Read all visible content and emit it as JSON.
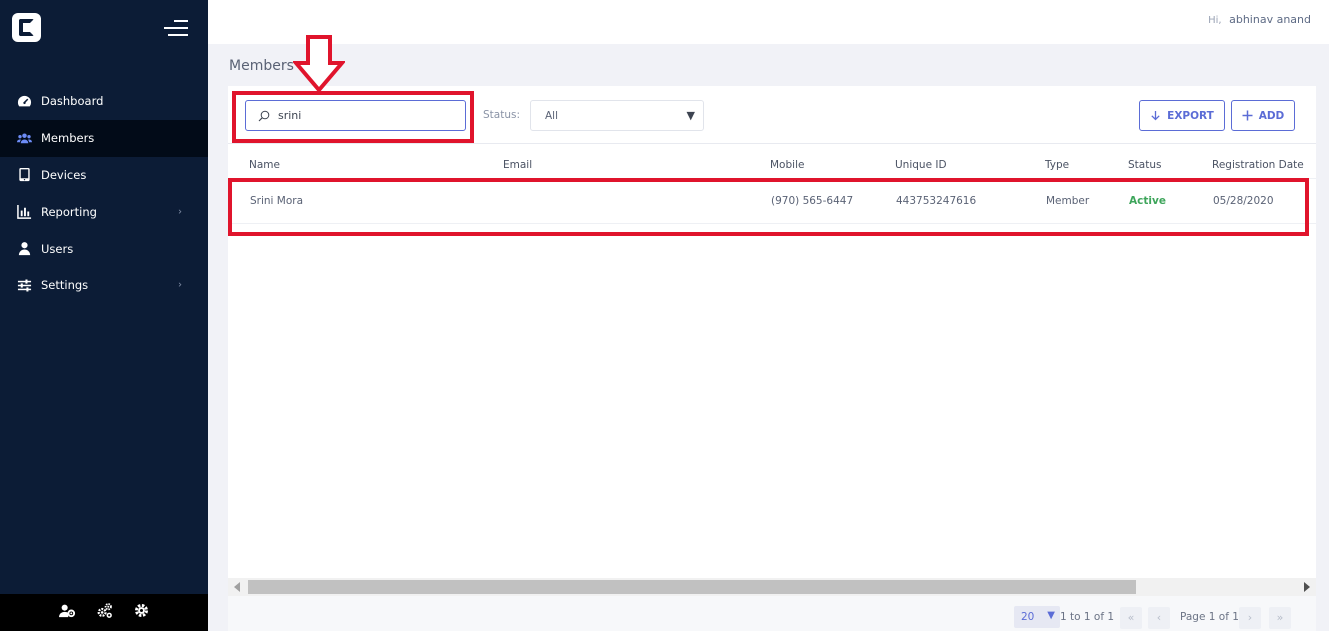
{
  "app": {
    "logo_letter": "C"
  },
  "sidebar": {
    "items": [
      {
        "label": "Dashboard",
        "icon": "dashboard-gauge-icon",
        "chevron": false
      },
      {
        "label": "Members",
        "icon": "members-group-icon",
        "chevron": false,
        "active": true
      },
      {
        "label": "Devices",
        "icon": "tablet-icon",
        "chevron": false
      },
      {
        "label": "Reporting",
        "icon": "bar-chart-icon",
        "chevron": true
      },
      {
        "label": "Users",
        "icon": "user-icon",
        "chevron": false
      },
      {
        "label": "Settings",
        "icon": "sliders-icon",
        "chevron": true
      }
    ],
    "footer_icons": [
      "user-settings-icon",
      "cogs-icon",
      "gear-icon"
    ]
  },
  "header": {
    "greeting": "Hi,",
    "username": "abhinav anand"
  },
  "page": {
    "title": "Members"
  },
  "toolbar": {
    "search_value": "srini",
    "status_label": "Status:",
    "status_value": "All",
    "export_label": "EXPORT",
    "add_label": "ADD"
  },
  "table": {
    "columns": [
      "Name",
      "Email",
      "Mobile",
      "Unique ID",
      "Type",
      "Status",
      "Registration Date"
    ],
    "rows": [
      {
        "name": "Srini Mora",
        "email": "",
        "mobile": "(970) 565-6447",
        "unique_id": "443753247616",
        "type": "Member",
        "status": "Active",
        "registration_date": "05/28/2020"
      }
    ]
  },
  "pagination": {
    "page_size": "20",
    "range_text": "1 to 1 of 1",
    "page_text": "Page 1 of 1"
  },
  "colors": {
    "sidebar_bg": "#0c1c36",
    "accent": "#5b6cd6",
    "status_active": "#3ea55b",
    "annotation": "#e0142c"
  }
}
